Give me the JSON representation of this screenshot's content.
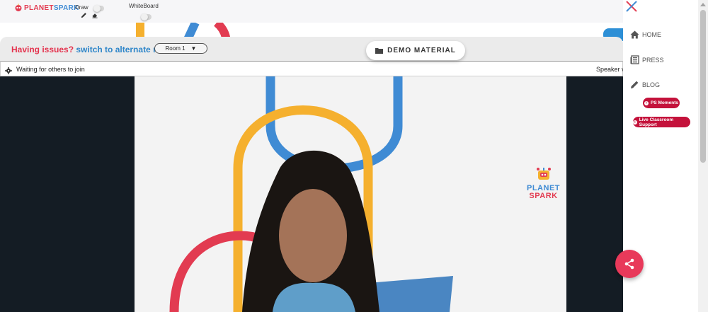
{
  "brand": {
    "logo_part1": "PLANET",
    "logo_part2": "SPARK",
    "watermark_line1": "PLANET",
    "watermark_line2": "SPARK"
  },
  "toolbar": {
    "draw_label": "Draw",
    "whiteboard_label": "WhiteBoard",
    "draw_enabled": false,
    "whiteboard_enabled": false
  },
  "issues": {
    "prefix": "Having issues?",
    "link": "switch to alternate room",
    "room_selected": "Room 1"
  },
  "demo_material": {
    "label": "DEMO MATERIAL",
    "icon": "folder-icon"
  },
  "status": {
    "waiting_text": "Waiting for others to join",
    "view_mode": "Speaker vi"
  },
  "sidebar": {
    "items": [
      {
        "label": "HOME",
        "icon": "home-icon"
      },
      {
        "label": "PRESS",
        "icon": "newspaper-icon"
      },
      {
        "label": "BLOG",
        "icon": "pencil-icon"
      }
    ],
    "pills": [
      {
        "label": "PS Moments",
        "icon": "plus-icon"
      },
      {
        "label": "Live Classroom Support",
        "icon": "plus-icon"
      }
    ]
  },
  "colors": {
    "brand_red": "#e23b51",
    "brand_blue": "#3f8bd4",
    "accent_yellow": "#f5b02e",
    "pill_red": "#c4123b",
    "fab_pink": "#e8395a",
    "video_bg": "#141c24"
  }
}
